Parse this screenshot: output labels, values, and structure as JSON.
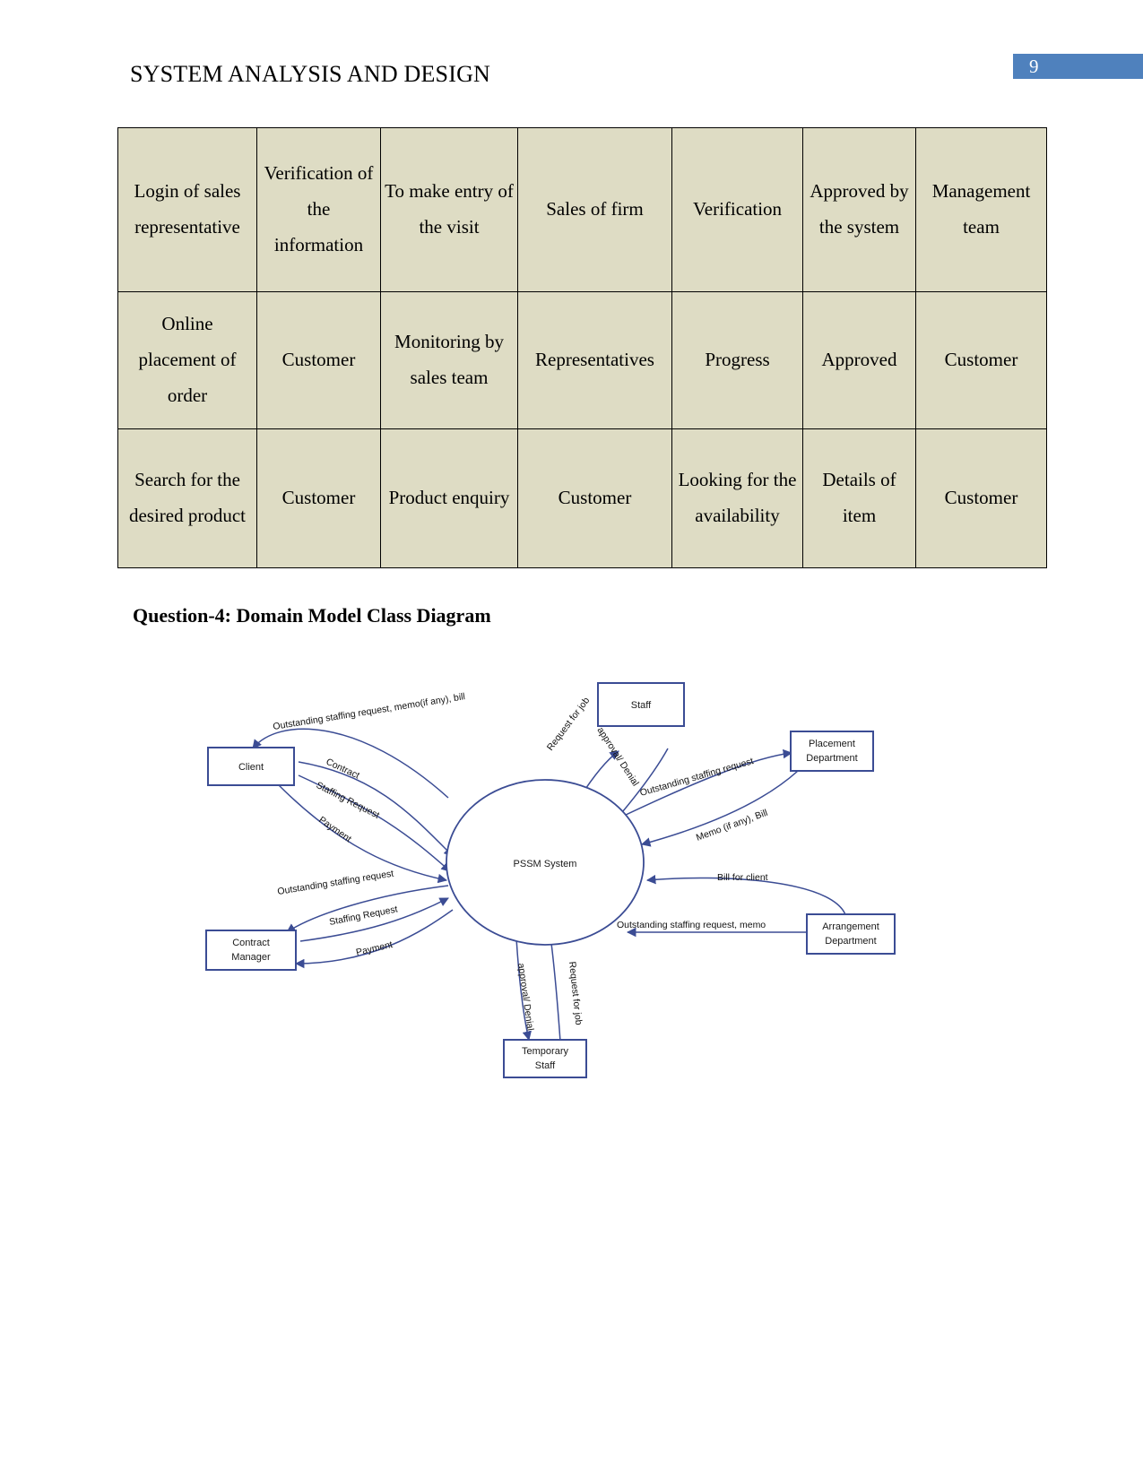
{
  "header": {
    "document_title": "SYSTEM ANALYSIS AND DESIGN",
    "page_number": "9",
    "page_number_color": "#4f81bd"
  },
  "table": {
    "fill_color": "#dedcc4",
    "rows": [
      [
        "Login of sales representative",
        "Verification of the information",
        "To make entry of the visit",
        "Sales of firm",
        "Verification",
        "Approved by the system",
        "Management team"
      ],
      [
        "Online placement of order",
        "Customer",
        "Monitoring by sales team",
        "Representatives",
        "Progress",
        "Approved",
        "Customer"
      ],
      [
        "Search for the desired product",
        "Customer",
        "Product enquiry",
        "Customer",
        "Looking for the availability",
        "Details of item",
        "Customer"
      ]
    ]
  },
  "question": {
    "heading": "Question-4: Domain Model Class Diagram"
  },
  "diagram": {
    "type": "context-data-flow-diagram",
    "accent_color": "#3b4c94",
    "center": {
      "id": "pssm-system",
      "label": "PSSM System",
      "shape": "circle"
    },
    "entities": [
      {
        "id": "staff",
        "label": "Staff",
        "shape": "rect"
      },
      {
        "id": "client",
        "label": "Client",
        "shape": "rect"
      },
      {
        "id": "contract-manager",
        "label": "Contract Manager",
        "line1": "Contract",
        "line2": "Manager",
        "shape": "rect"
      },
      {
        "id": "placement-department",
        "label": "Placement Department",
        "line1": "Placement",
        "line2": "Department",
        "shape": "rect"
      },
      {
        "id": "arrangement-department",
        "label": "Arrangement Department",
        "line1": "Arrangement",
        "line2": "Department",
        "shape": "rect"
      },
      {
        "id": "temporary-staff",
        "label": "Temporary Staff",
        "line1": "Temporary",
        "line2": "Staff",
        "shape": "rect"
      }
    ],
    "flows": [
      {
        "id": "flow-client-out",
        "label": "Outstanding staffing request, memo(if any), bill",
        "from": "pssm-system",
        "to": "client"
      },
      {
        "id": "flow-client-contract",
        "label": "Contract",
        "from": "client",
        "to": "pssm-system"
      },
      {
        "id": "flow-client-staffing-request",
        "label": "Staffing Request",
        "from": "client",
        "to": "pssm-system"
      },
      {
        "id": "flow-client-payment",
        "label": "Payment",
        "from": "client",
        "to": "pssm-system"
      },
      {
        "id": "flow-staff-request-for-job",
        "label": "Request for job",
        "from": "staff",
        "to": "pssm-system"
      },
      {
        "id": "flow-staff-approval-denial",
        "label": "approval/ Denial",
        "from": "pssm-system",
        "to": "staff"
      },
      {
        "id": "flow-placement-outstanding",
        "label": "Outstanding staffing request",
        "from": "pssm-system",
        "to": "placement-department"
      },
      {
        "id": "flow-placement-memo-bill",
        "label": "Memo (if any), Bill",
        "from": "placement-department",
        "to": "pssm-system"
      },
      {
        "id": "flow-arrangement-bill-for-client",
        "label": "Bill for client",
        "from": "arrangement-department",
        "to": "pssm-system"
      },
      {
        "id": "flow-arrangement-outstanding",
        "label": "Outstanding staffing request,  memo",
        "from": "pssm-system",
        "to": "arrangement-department"
      },
      {
        "id": "flow-contract-manager-outstanding",
        "label": "Outstanding staffing request",
        "from": "pssm-system",
        "to": "contract-manager"
      },
      {
        "id": "flow-contract-manager-staffing-request",
        "label": "Staffing Request",
        "from": "contract-manager",
        "to": "pssm-system"
      },
      {
        "id": "flow-contract-manager-payment",
        "label": "Payment",
        "from": "contract-manager",
        "to": "pssm-system"
      },
      {
        "id": "flow-temp-staff-approval-denial",
        "label": "approval/ Denial",
        "from": "pssm-system",
        "to": "temporary-staff"
      },
      {
        "id": "flow-temp-staff-request-for-job",
        "label": "Request for job",
        "from": "temporary-staff",
        "to": "pssm-system"
      }
    ]
  }
}
